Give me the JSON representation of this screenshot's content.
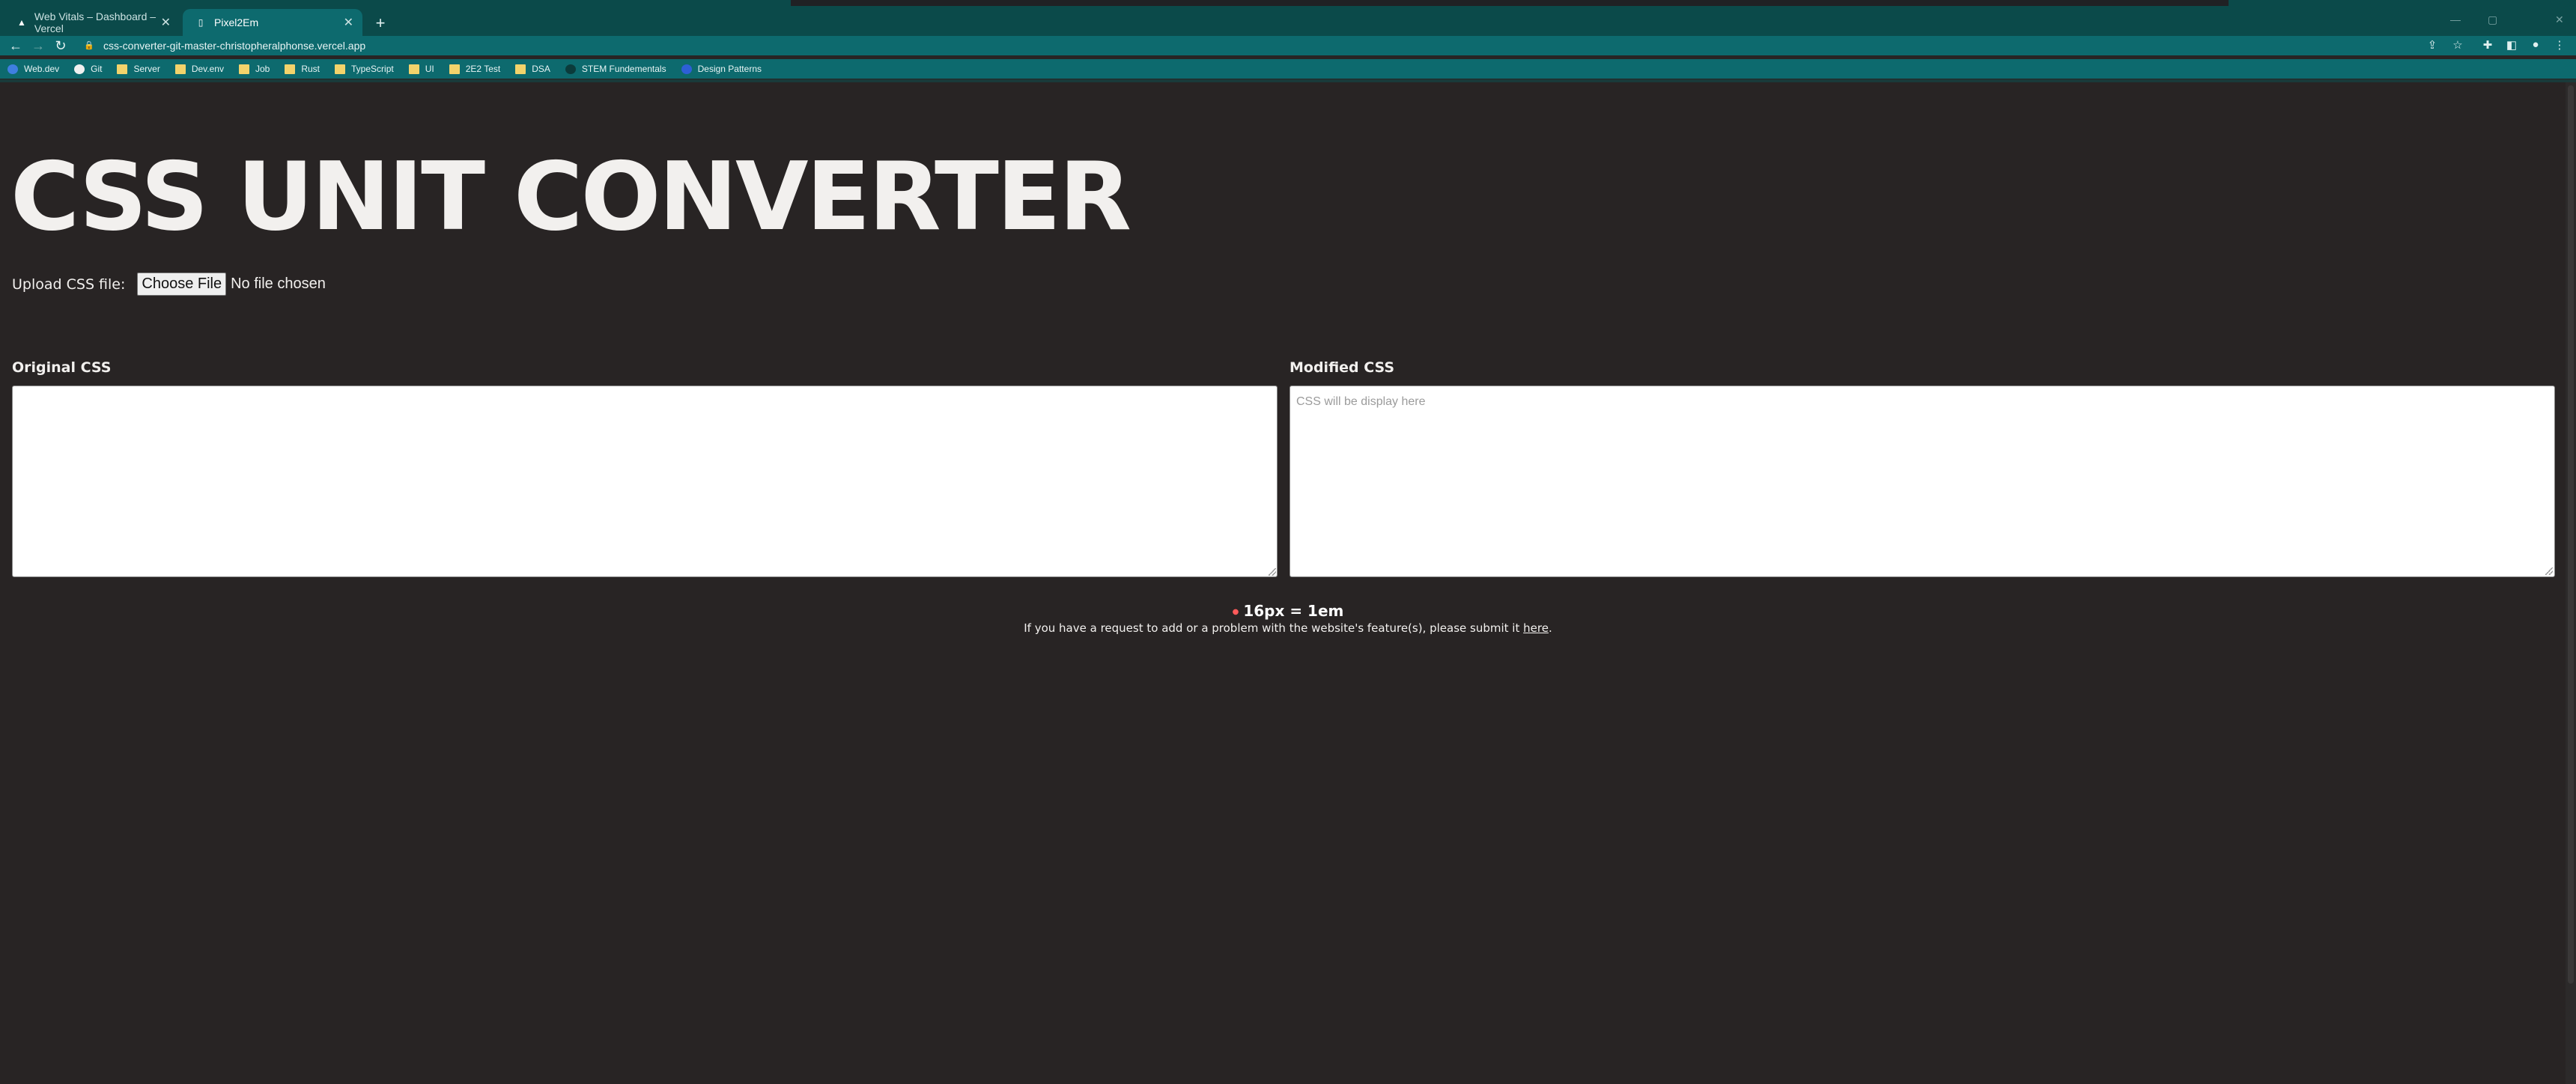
{
  "browser": {
    "tabs": [
      {
        "title": "Web Vitals – Dashboard – Vercel",
        "active": false,
        "icon": "vercel-triangle-icon"
      },
      {
        "title": "Pixel2Em",
        "active": true,
        "icon": "page-icon"
      }
    ],
    "url": "css-converter-git-master-christopheralphonse.vercel.app",
    "bookmarks": [
      {
        "label": "Web.dev",
        "icon": "webdev-icon"
      },
      {
        "label": "Git",
        "icon": "github-icon"
      },
      {
        "label": "Server",
        "icon": "folder-icon"
      },
      {
        "label": "Dev.env",
        "icon": "folder-icon"
      },
      {
        "label": "Job",
        "icon": "folder-icon"
      },
      {
        "label": "Rust",
        "icon": "folder-icon"
      },
      {
        "label": "TypeScript",
        "icon": "folder-icon"
      },
      {
        "label": "UI",
        "icon": "folder-icon"
      },
      {
        "label": "2E2 Test",
        "icon": "folder-icon"
      },
      {
        "label": "DSA",
        "icon": "folder-icon"
      },
      {
        "label": "STEM Fundementals",
        "icon": "stem-icon"
      },
      {
        "label": "Design Patterns",
        "icon": "design-patterns-icon"
      }
    ]
  },
  "page": {
    "title": "CSS UNIT CONVERTER",
    "upload_label": "Upload CSS file:",
    "file_button": "Choose File",
    "file_status": "No file chosen",
    "original_label": "Original CSS",
    "original_value": "",
    "modified_label": "Modified CSS",
    "modified_placeholder": "CSS will be display here",
    "ratio": "16px = 1em",
    "footer_text": "If you have a request to add or a problem with the website's feature(s), please submit it",
    "footer_link": "here",
    "footer_end": "."
  },
  "colors": {
    "background": "#282424",
    "chrome": "#0d6a6e",
    "accent_dot": "#ff5a5a"
  }
}
